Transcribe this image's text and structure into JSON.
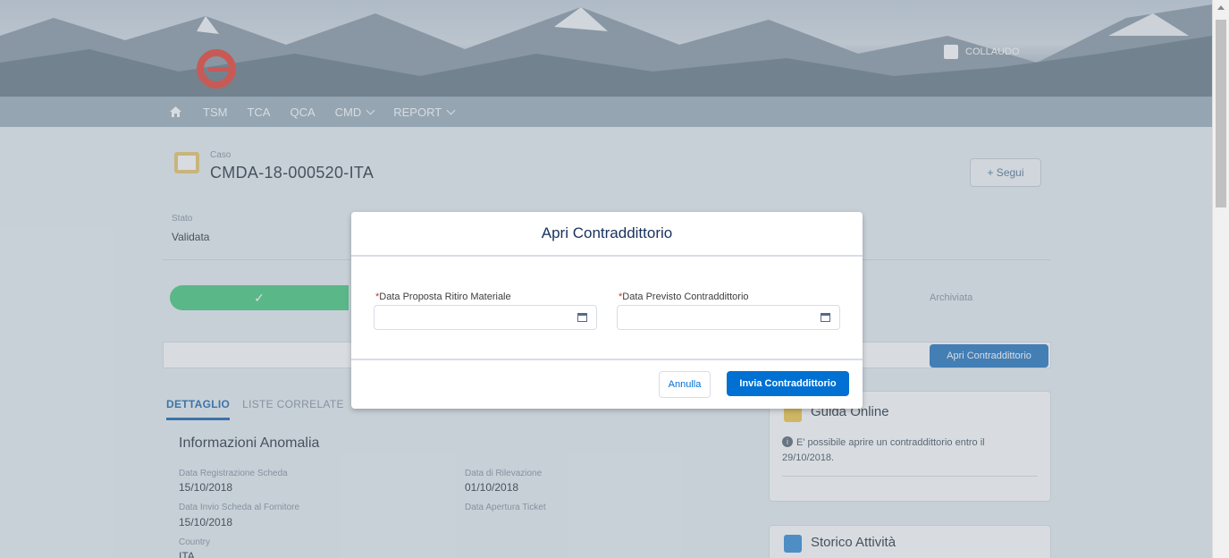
{
  "header": {
    "user_name": "COLLAUDO"
  },
  "nav": {
    "items": [
      "TSM",
      "TCA",
      "QCA",
      "CMD",
      "REPORT"
    ]
  },
  "case": {
    "type_label": "Caso",
    "number": "CMDA-18-000520-ITA",
    "follow_label": "+ Segui",
    "status_label": "Stato",
    "status_value": "Validata"
  },
  "path": {
    "completed_check": "✓",
    "last_step": "Archiviata"
  },
  "actions": {
    "open_dispute_label": "Apri Contraddittorio"
  },
  "tabs": [
    "DETTAGLIO",
    "LISTE CORRELATE"
  ],
  "details": {
    "section_title": "Informazioni Anomalia",
    "fields": [
      {
        "label": "Data Registrazione Scheda",
        "value": "15/10/2018"
      },
      {
        "label": "Data di Rilevazione",
        "value": "01/10/2018"
      },
      {
        "label": "Data Invio Scheda al Fornitore",
        "value": "15/10/2018"
      },
      {
        "label": "Data Apertura Ticket",
        "value": ""
      },
      {
        "label": "Country",
        "value": "ITA"
      }
    ]
  },
  "guide": {
    "title": "Guida Online",
    "info": "E' possibile aprire un contraddittorio entro il 29/10/2018."
  },
  "history": {
    "title": "Storico Attività"
  },
  "modal": {
    "title": "Apri Contraddittorio",
    "required_mark": "*",
    "field1_label": "Data Proposta Ritiro Materiale",
    "field1_value": "",
    "field2_label": "Data Previsto Contraddittorio",
    "field2_value": "",
    "cancel_label": "Annulla",
    "submit_label": "Invia Contraddittorio"
  },
  "colors": {
    "brand": "#0070d2",
    "logo": "#e9463a",
    "path_complete": "#4bca81",
    "required": "#c23934"
  }
}
